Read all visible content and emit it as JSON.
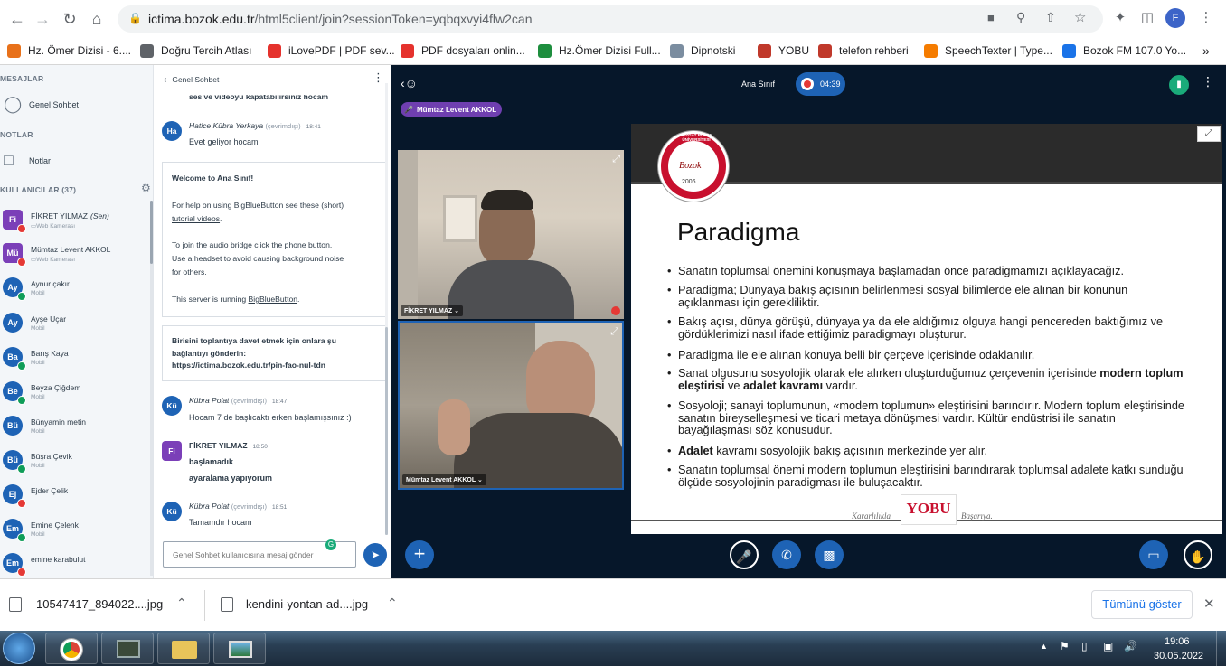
{
  "browser": {
    "url_host": "ictima.bozok.edu.tr",
    "url_rest": "/html5client/join?sessionToken=yqbqxvyi4flw2can",
    "profile_initial": "F",
    "bookmarks": [
      {
        "label": "Hz. Ömer Dizisi - 6....",
        "color": "#e8711a"
      },
      {
        "label": "Doğru Tercih Atlası",
        "color": "#5f6368"
      },
      {
        "label": "iLovePDF | PDF sev...",
        "color": "#e5322d"
      },
      {
        "label": "PDF dosyaları onlin...",
        "color": "#e5322d"
      },
      {
        "label": "Hz.Ömer Dizisi Full...",
        "color": "#1e8e3e"
      },
      {
        "label": "Dipnotski",
        "color": "#7b8da0"
      },
      {
        "label": "YOBU",
        "color": "#c0392b"
      },
      {
        "label": "telefon rehberi",
        "color": "#c0392b"
      },
      {
        "label": "SpeechTexter | Type...",
        "color": "#f57c00"
      },
      {
        "label": "Bozok FM 107.0 Yo...",
        "color": "#1a73e8"
      }
    ],
    "more_bookmarks": "»"
  },
  "sidebar": {
    "messages_title": "MESAJLAR",
    "public_chat": "Genel Sohbet",
    "notes_title": "NOTLAR",
    "notes": "Notlar",
    "users_title": "KULLANICILAR (37)",
    "users": [
      {
        "initials": "Fi",
        "name": "FİKRET YILMAZ",
        "you": "(Sen)",
        "sub": "Web Kamerası",
        "color": "#7b3fb8",
        "shape": "square",
        "status": "#e53935"
      },
      {
        "initials": "Mü",
        "name": "Mümtaz Levent AKKOL",
        "you": "",
        "sub": "Web Kamerası",
        "color": "#7b3fb8",
        "shape": "square",
        "status": "#e53935"
      },
      {
        "initials": "Ay",
        "name": "Aynur çakır",
        "you": "",
        "sub": "Mobil",
        "color": "#1e63b5",
        "shape": "round",
        "status": "#0f9d58"
      },
      {
        "initials": "Ay",
        "name": "Ayşe Uçar",
        "you": "",
        "sub": "Mobil",
        "color": "#1e63b5",
        "shape": "round",
        "status": ""
      },
      {
        "initials": "Ba",
        "name": "Barış Kaya",
        "you": "",
        "sub": "Mobil",
        "color": "#1e63b5",
        "shape": "round",
        "status": "#0f9d58"
      },
      {
        "initials": "Be",
        "name": "Beyza Çiğdem",
        "you": "",
        "sub": "Mobil",
        "color": "#1e63b5",
        "shape": "round",
        "status": "#0f9d58"
      },
      {
        "initials": "Bü",
        "name": "Bünyamin metin",
        "you": "",
        "sub": "Mobil",
        "color": "#1e63b5",
        "shape": "round",
        "status": ""
      },
      {
        "initials": "Bü",
        "name": "Büşra Çevik",
        "you": "",
        "sub": "Mobil",
        "color": "#1e63b5",
        "shape": "round",
        "status": "#0f9d58"
      },
      {
        "initials": "Ej",
        "name": "Ejder Çelik",
        "you": "",
        "sub": "",
        "color": "#1e63b5",
        "shape": "round",
        "status": "#e53935"
      },
      {
        "initials": "Em",
        "name": "Emine Çelenk",
        "you": "",
        "sub": "Mobil",
        "color": "#1e63b5",
        "shape": "round",
        "status": "#0f9d58"
      },
      {
        "initials": "Em",
        "name": "emine karabulut",
        "you": "",
        "sub": "",
        "color": "#1e63b5",
        "shape": "round",
        "status": "#e53935"
      }
    ]
  },
  "chat": {
    "title": "Genel Sohbet",
    "cut_text": "ses ve videoyu kapatabilirsiniz hocam",
    "welcome_lines": [
      "Welcome to ",
      "Ana Sınıf",
      "!"
    ],
    "help_text": "For help on using BigBlueButton see these (short)",
    "tutorial_link": "tutorial videos",
    "audio_text_1": "To join the audio bridge click the phone button.",
    "audio_text_2": "Use a headset to avoid causing background noise",
    "audio_text_3": "for others.",
    "server_text": "This server is running ",
    "server_link": "BigBlueButton",
    "invite_1": "Birisini toplantıya davet etmek için onlara şu",
    "invite_2": "bağlantıyı gönderin:",
    "invite_3": "https://ictima.bozok.edu.tr/pin-fao-nul-tdn",
    "messages": [
      {
        "initials": "Ha",
        "author": "Hatice Kübra Yerkaya",
        "offline": "(çevrimdışı)",
        "time": "18:41",
        "lines": [
          "Evet geliyor hocam"
        ],
        "color": "#1e63b5"
      },
      {
        "initials": "Kü",
        "author": "Kübra Polat",
        "offline": "(çevrimdışı)",
        "time": "18:47",
        "lines": [
          "Hocam 7 de başlıcaktı erken başlamışsınız :)"
        ],
        "color": "#1e63b5"
      },
      {
        "initials": "Fi",
        "author": "FİKRET YILMAZ",
        "offline": "",
        "time": "18:50",
        "lines": [
          "başlamadık",
          "ayaralama yapıyorum"
        ],
        "color": "#7b3fb8"
      },
      {
        "initials": "Kü",
        "author": "Kübra Polat",
        "offline": "(çevrimdışı)",
        "time": "18:51",
        "lines": [
          "Tamamdır hocam"
        ],
        "color": "#1e63b5"
      }
    ],
    "input_placeholder": "Genel Sohbet kullanıcısına mesaj gönder"
  },
  "meeting": {
    "name": "Ana Sınıf",
    "recording_time": "04:39",
    "talking": "Mümtaz Levent AKKOL",
    "videos": [
      {
        "name": "FİKRET YILMAZ"
      },
      {
        "name": "Mümtaz Levent AKKOL"
      }
    ]
  },
  "slide": {
    "logo_text": "YOZGAT BOZOK ÜNİVERSİTESİ",
    "logo_year": "2006",
    "title": "Paradigma",
    "bullets": [
      [
        {
          "t": "Sanatın toplumsal önemini konuşmaya başlamadan önce paradigmamızı açıklayacağız.",
          "b": false
        }
      ],
      [
        {
          "t": "Paradigma; Dünyaya bakış açısının belirlenmesi sosyal bilimlerde ele alınan bir konunun açıklanması için gerekliliktir.",
          "b": false
        }
      ],
      [
        {
          "t": "Bakış açısı, dünya görüşü, dünyaya ya da ele aldığımız olguya hangi pencereden baktığımız ve gördüklerimizi nasıl ifade ettiğimiz paradigmayı oluşturur.",
          "b": false
        }
      ],
      [
        {
          "t": "Paradigma ile ele alınan konuya belli bir çerçeve içerisinde odaklanılır.",
          "b": false
        }
      ],
      [
        {
          "t": "Sanat olgusunu sosyolojik olarak ele alırken oluşturduğumuz çerçevenin içerisinde ",
          "b": false
        },
        {
          "t": "modern toplum eleştirisi",
          "b": true
        },
        {
          "t": " ve ",
          "b": false
        },
        {
          "t": "adalet kavramı",
          "b": true
        },
        {
          "t": " vardır.",
          "b": false
        }
      ],
      [
        {
          "t": "Sosyoloji; sanayi toplumunun, «modern toplumun» eleştirisini barındırır. Modern toplum eleştirisinde sanatın bireyselleşmesi ve ticari metaya dönüşmesi vardır. Kültür endüstrisi ile sanatın bayağılaşması söz konusudur.",
          "b": false
        }
      ],
      [
        {
          "t": "Adalet",
          "b": true
        },
        {
          "t": " kavramı sosyolojik bakış açısının merkezinde yer alır.",
          "b": false
        }
      ],
      [
        {
          "t": "Sanatın toplumsal önemi  modern toplumun eleştirisini barındırarak  toplumsal adalete katkı sunduğu ölçüde sosyolojinin paradigması ile buluşacaktır.",
          "b": false
        }
      ]
    ],
    "footer_left": "Kararlılıkla",
    "footer_brand": "YOBU",
    "footer_right": "Başarıya."
  },
  "downloads": {
    "files": [
      "10547417_894022....jpg",
      "kendini-yontan-ad....jpg"
    ],
    "show_all": "Tümünü göster"
  },
  "taskbar": {
    "time": "19:06",
    "date": "30.05.2022"
  }
}
